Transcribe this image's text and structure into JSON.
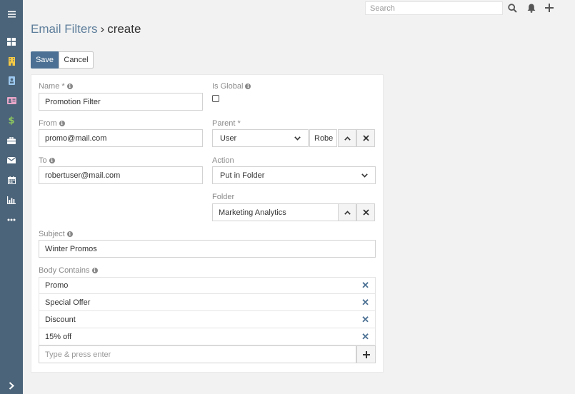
{
  "topbar": {
    "search_placeholder": "Search",
    "icons": [
      "search-icon",
      "bell-icon",
      "plus-icon"
    ]
  },
  "sidebar": {
    "items": [
      {
        "name": "menu",
        "icon": "hamburger-icon",
        "color": "#ffffff"
      },
      {
        "name": "dashboard",
        "icon": "dashboard-icon",
        "color": "#ffffff"
      },
      {
        "name": "accounts",
        "icon": "building-icon",
        "color": "#f5c945"
      },
      {
        "name": "contacts",
        "icon": "contact-card-icon",
        "color": "#9cc8ef"
      },
      {
        "name": "leads",
        "icon": "id-card-icon",
        "color": "#e8a6c8"
      },
      {
        "name": "opportunities",
        "icon": "dollar-icon",
        "color": "#8ec85e"
      },
      {
        "name": "cases",
        "icon": "briefcase-icon",
        "color": "#ffffff"
      },
      {
        "name": "emails",
        "icon": "envelope-icon",
        "color": "#ffffff"
      },
      {
        "name": "calendar",
        "icon": "calendar-icon",
        "color": "#ffffff"
      },
      {
        "name": "reports",
        "icon": "bar-chart-icon",
        "color": "#ffffff"
      },
      {
        "name": "more",
        "icon": "ellipsis-icon",
        "color": "#ffffff"
      },
      {
        "name": "expand",
        "icon": "chevron-right-icon",
        "color": "#ffffff"
      }
    ]
  },
  "header": {
    "link": "Email Filters",
    "separator": "›",
    "current": "create"
  },
  "buttons": {
    "save": "Save",
    "cancel": "Cancel"
  },
  "form": {
    "name": {
      "label": "Name *",
      "value": "Promotion Filter"
    },
    "is_global": {
      "label": "Is Global",
      "checked": false
    },
    "from": {
      "label": "From",
      "value": "promo@mail.com"
    },
    "parent": {
      "label": "Parent *",
      "type_value": "User",
      "name_value": "Robe"
    },
    "to": {
      "label": "To",
      "value": "robertuser@mail.com"
    },
    "action": {
      "label": "Action",
      "value": "Put in Folder"
    },
    "folder": {
      "label": "Folder",
      "value": "Marketing Analytics"
    },
    "subject": {
      "label": "Subject",
      "value": "Winter Promos"
    },
    "body_contains": {
      "label": "Body Contains",
      "items": [
        "Promo",
        "Special Offer",
        "Discount",
        "15% off"
      ],
      "placeholder": "Type & press enter"
    }
  },
  "colors": {
    "sidebar": "#4c6479",
    "accent": "#4b7093",
    "link": "#5d7e9b"
  }
}
